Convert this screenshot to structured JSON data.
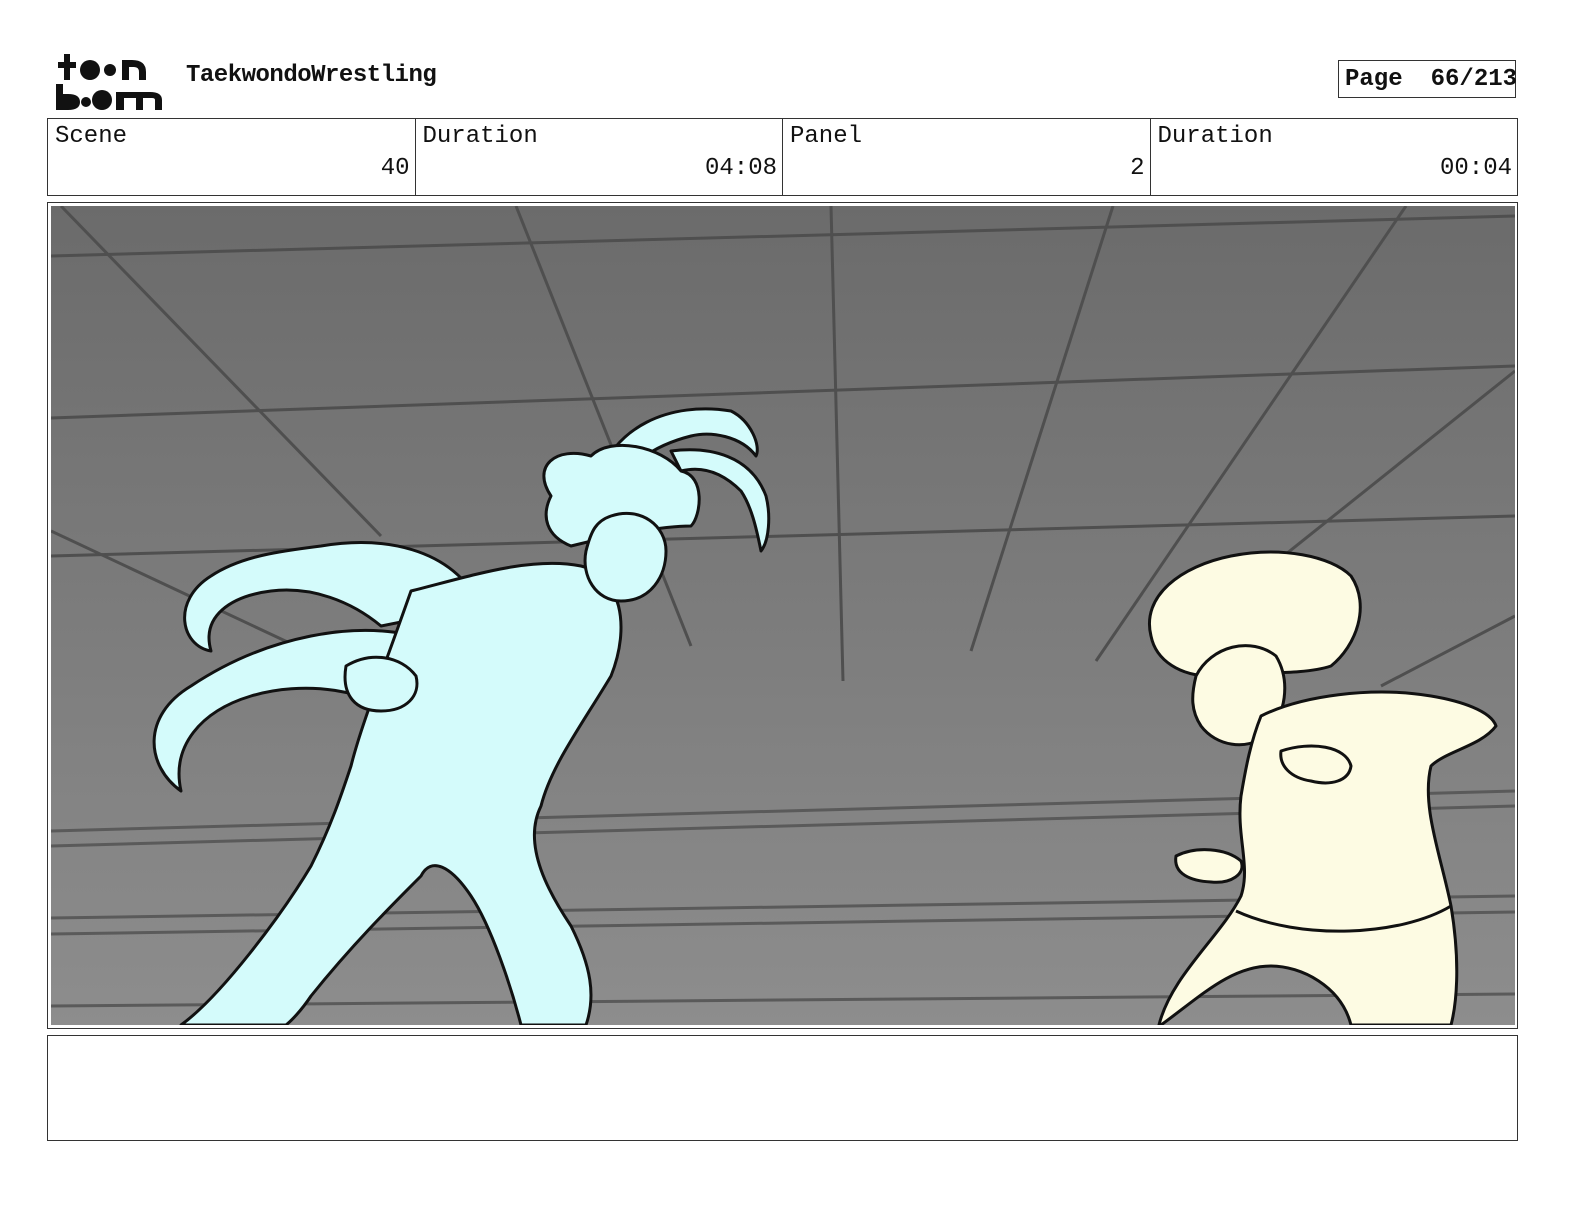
{
  "header": {
    "logo_text": "toon boom",
    "project_title": "TaekwondoWrestling",
    "page_label": "Page",
    "page_value": "66/213"
  },
  "info": {
    "scene_label": "Scene",
    "scene_value": "40",
    "scene_duration_label": "Duration",
    "scene_duration_value": "04:08",
    "panel_label": "Panel",
    "panel_value": "2",
    "panel_duration_label": "Duration",
    "panel_duration_value": "00:04"
  },
  "panel": {
    "description": "",
    "colors": {
      "background": "#7a7a7a",
      "left_fighter": "#d4fbfb",
      "right_fighter": "#fdfbe3",
      "line": "#111111",
      "grid": "#555555"
    }
  },
  "notes": {
    "text": ""
  }
}
